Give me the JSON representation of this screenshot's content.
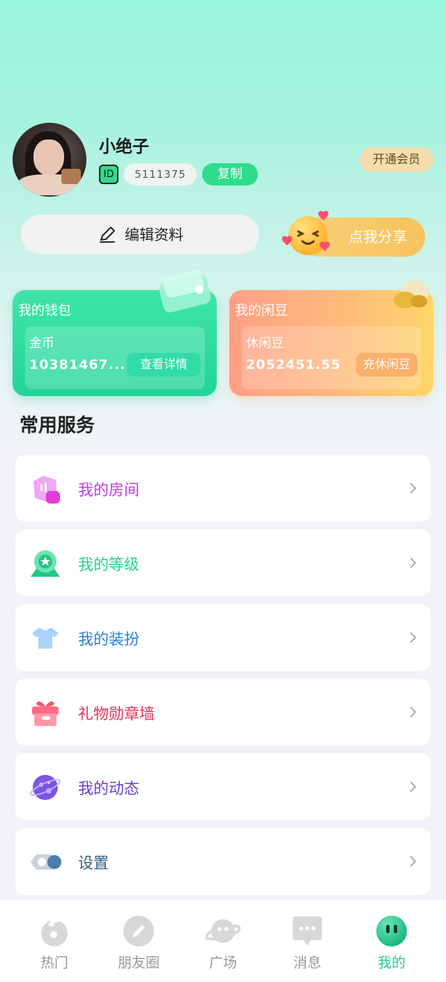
{
  "profile": {
    "name": "小绝子",
    "id_badge": "ID",
    "id_value": "5111375",
    "copy_label": "复制",
    "vip_label": "开通会员",
    "edit_label": "编辑资料",
    "share_label": "点我分享"
  },
  "cards": {
    "wallet": {
      "title": "我的钱包",
      "label": "金币",
      "value": "10381467...",
      "action": "查看详情"
    },
    "beans": {
      "title": "我的闲豆",
      "label": "休闲豆",
      "value": "2052451.55",
      "action": "充休闲豆"
    }
  },
  "services": {
    "title": "常用服务",
    "items": [
      {
        "label": "我的房间",
        "color": "#c23be0",
        "icon": "room-icon"
      },
      {
        "label": "我的等级",
        "color": "#2ccf8b",
        "icon": "level-icon"
      },
      {
        "label": "我的装扮",
        "color": "#2a7fd6",
        "icon": "outfit-icon"
      },
      {
        "label": "礼物勋章墙",
        "color": "#e8325a",
        "icon": "gift-icon"
      },
      {
        "label": "我的动态",
        "color": "#6a3fd1",
        "icon": "moments-icon"
      },
      {
        "label": "设置",
        "color": "#315f86",
        "icon": "settings-icon"
      }
    ]
  },
  "nav": {
    "items": [
      {
        "label": "热门",
        "icon": "hot-icon"
      },
      {
        "label": "朋友圈",
        "icon": "friends-icon"
      },
      {
        "label": "广场",
        "icon": "planet-icon"
      },
      {
        "label": "消息",
        "icon": "message-icon"
      },
      {
        "label": "我的",
        "icon": "me-icon"
      }
    ],
    "active_index": 4,
    "accent": "#25c98b"
  }
}
